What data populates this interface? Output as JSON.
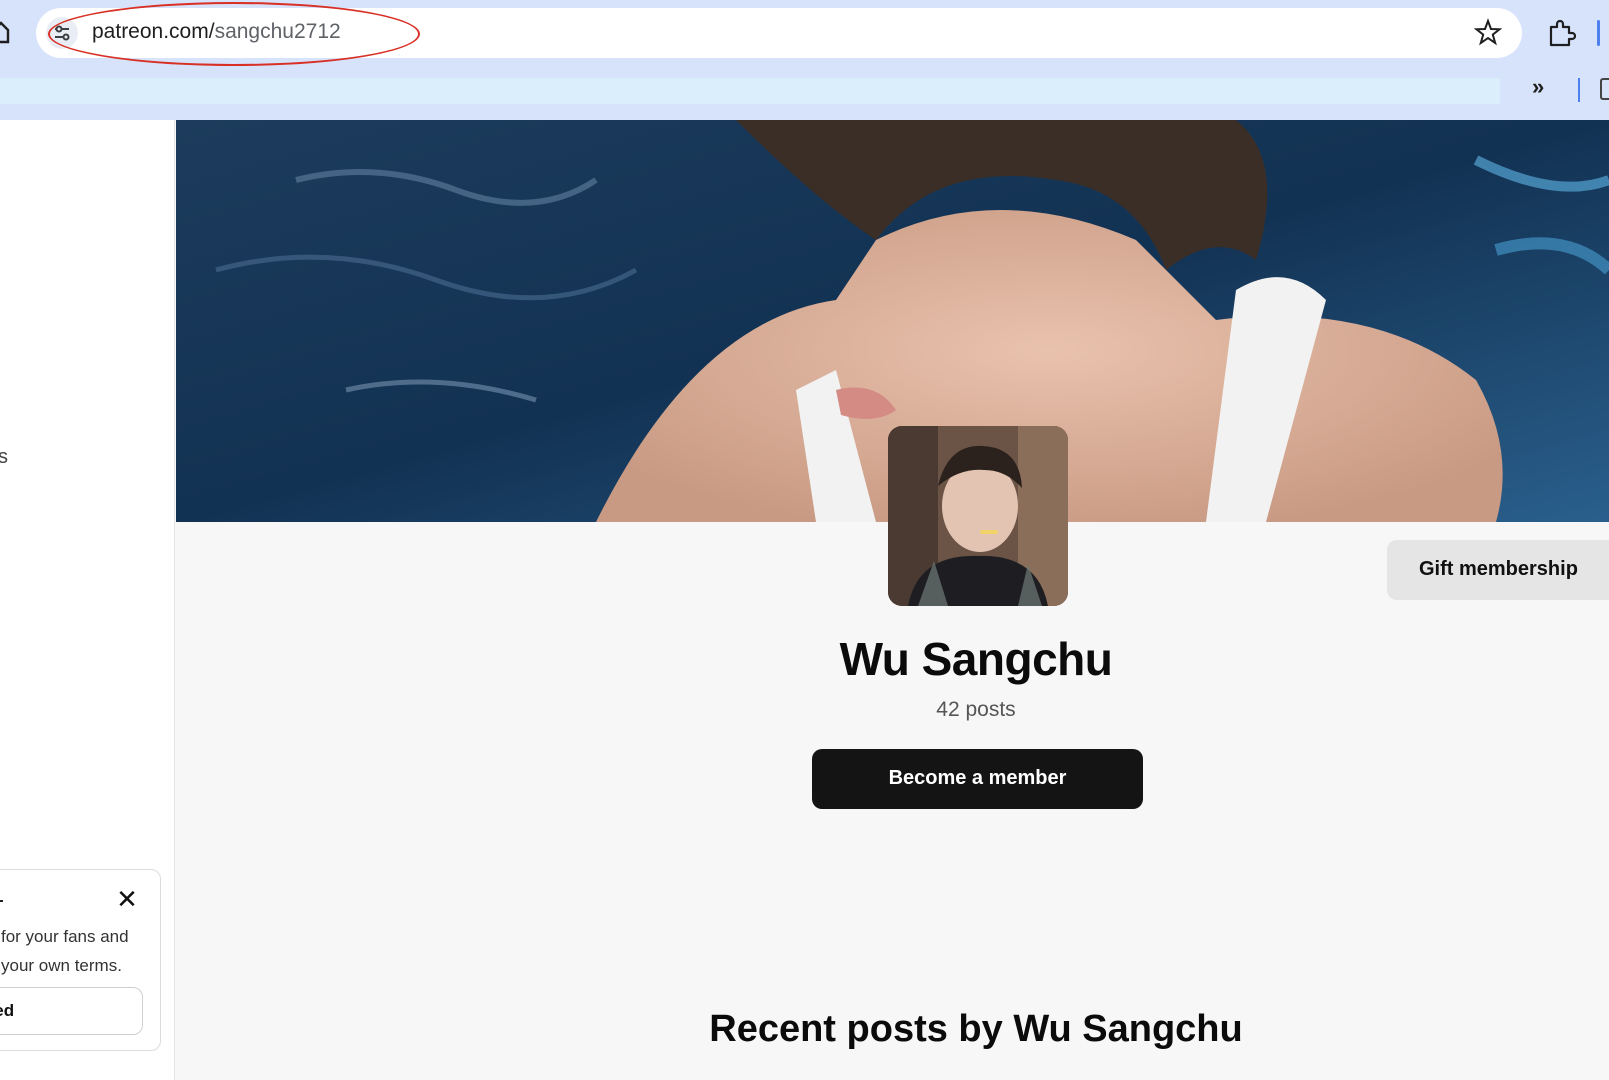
{
  "browser": {
    "url_domain": "patreon.com/",
    "url_path": "sangchu2712"
  },
  "sidebar": {
    "partial_label": "s",
    "promo": {
      "text_line1": "for your fans and",
      "text_line2": "your own terms.",
      "button_label": "rted"
    }
  },
  "profile": {
    "name": "Wu Sangchu",
    "post_count": "42 posts",
    "become_member_label": "Become a member",
    "gift_membership_label": "Gift membership"
  },
  "recent_posts": {
    "title": "Recent posts by Wu Sangchu"
  },
  "colors": {
    "chrome_bg": "#d6e3fb",
    "primary_button": "#141414",
    "annotation_circle": "#d93025"
  }
}
